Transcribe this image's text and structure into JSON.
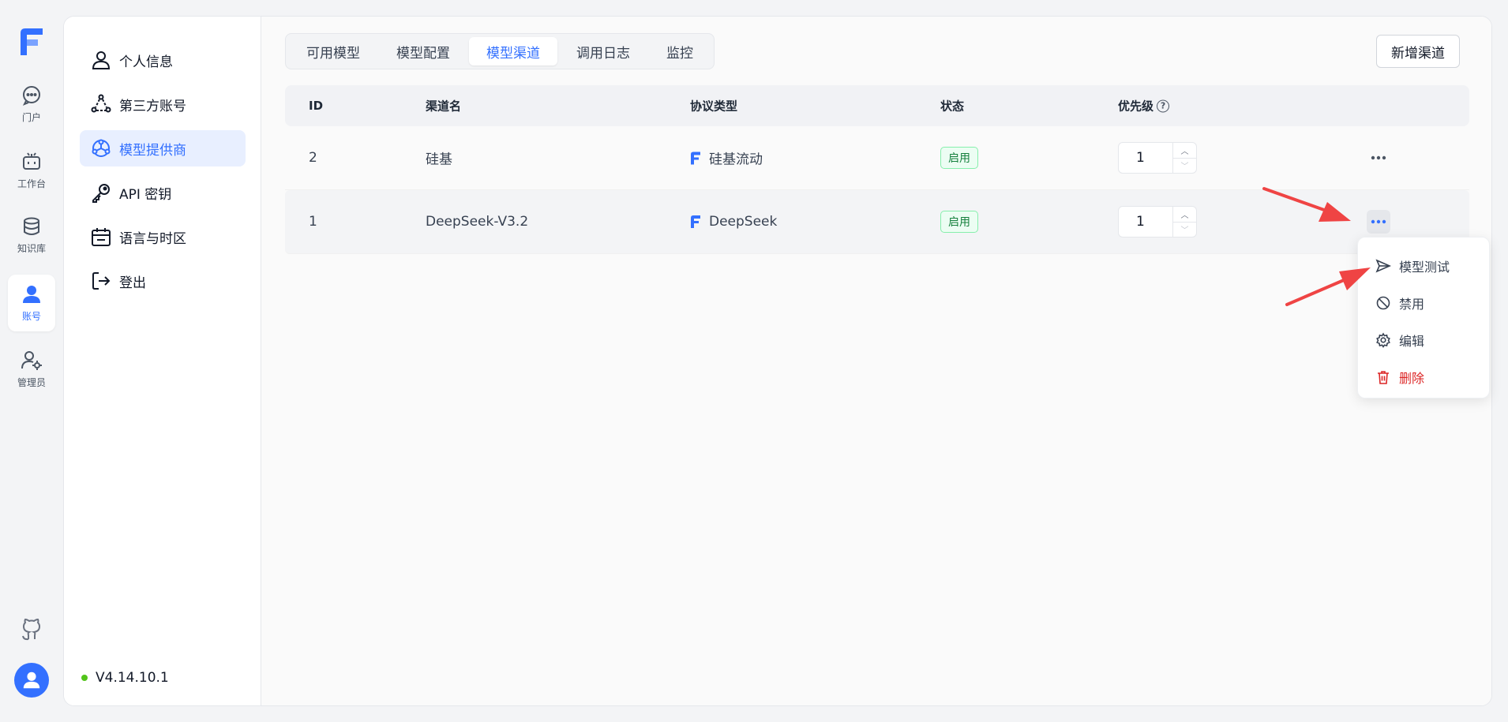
{
  "rail": {
    "items": [
      {
        "label": "门户",
        "icon": "chat-bubble-icon"
      },
      {
        "label": "工作台",
        "icon": "robot-icon"
      },
      {
        "label": "知识库",
        "icon": "database-icon"
      },
      {
        "label": "账号",
        "icon": "user-icon",
        "active": true
      },
      {
        "label": "管理员",
        "icon": "user-gear-icon"
      }
    ]
  },
  "sidebar": {
    "items": [
      {
        "label": "个人信息",
        "icon": "user-outline-icon"
      },
      {
        "label": "第三方账号",
        "icon": "triangle-network-icon"
      },
      {
        "label": "模型提供商",
        "icon": "hub-network-icon",
        "active": true
      },
      {
        "label": "API 密钥",
        "icon": "key-icon"
      },
      {
        "label": "语言与时区",
        "icon": "calendar-icon"
      },
      {
        "label": "登出",
        "icon": "logout-icon"
      }
    ],
    "version": "V4.14.10.1"
  },
  "tabs": [
    "可用模型",
    "模型配置",
    "模型渠道",
    "调用日志",
    "监控"
  ],
  "active_tab": "模型渠道",
  "add_button": "新增渠道",
  "table": {
    "columns": {
      "id": "ID",
      "name": "渠道名",
      "protocol": "协议类型",
      "status": "状态",
      "priority": "优先级"
    },
    "rows": [
      {
        "id": "2",
        "name": "硅基",
        "protocol": "硅基流动",
        "status": "启用",
        "priority": "1"
      },
      {
        "id": "1",
        "name": "DeepSeek-V3.2",
        "protocol": "DeepSeek",
        "status": "启用",
        "priority": "1"
      }
    ]
  },
  "dropdown": {
    "items": [
      {
        "label": "模型测试",
        "icon": "send-icon"
      },
      {
        "label": "禁用",
        "icon": "ban-icon"
      },
      {
        "label": "编辑",
        "icon": "gear-icon"
      },
      {
        "label": "删除",
        "icon": "trash-icon",
        "danger": true
      }
    ]
  },
  "colors": {
    "accent": "#3370ff",
    "danger": "#dc2626",
    "success": "#15803d",
    "annotation": "#ef4444"
  }
}
